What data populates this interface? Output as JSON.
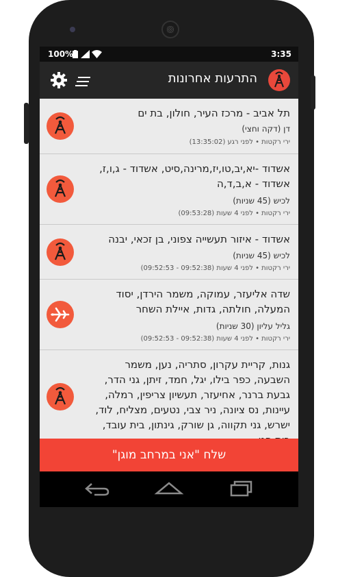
{
  "status_bar": {
    "battery": "100%",
    "time": "3:35"
  },
  "app_bar": {
    "title": "התרעות אחרונות"
  },
  "alerts": [
    {
      "cities": "תל אביב - מרכז העיר, חולון, בת ים",
      "duration": "דן (דקה וחצי)",
      "meta": "ירי רקטות • לפני רגע (13:35:02)",
      "icon": "rocket-tower-icon"
    },
    {
      "cities": "אשדוד -יא,יב,טו,יז,מרינה,סיט, אשדוד - ג,ו,ז, אשדוד - א,ב,ד,ה",
      "duration": "לכיש (45 שניות)",
      "meta": "ירי רקטות • לפני 4 שעות (09:53:28)",
      "icon": "rocket-tower-icon"
    },
    {
      "cities": "אשדוד - איזור תעשייה צפוני, בן זכאי, יבנה",
      "duration": "לכיש (45 שניות)",
      "meta": "ירי רקטות • לפני 4 שעות (09:52:38 - 09:52:53)",
      "icon": "rocket-tower-icon"
    },
    {
      "cities": "שדה אליעזר, עמוקה, משמר הירדן, יסוד המעלה, חולתה, גדות, איילת השחר",
      "duration": "גליל עליון (30 שניות)",
      "meta": "ירי רקטות • לפני 4 שעות (09:52:38 - 09:52:53)",
      "icon": "airplane-icon"
    },
    {
      "cities": "גנות, קריית עקרון, סתריה, נען, משמר השבעה, כפר בילו, יגל, חמד, זיתן, גני הדר, גבעת ברנר, אחיעזר, תעשיון צריפין, רמלה, עיינות, נס ציונה, ניר צבי, נטעים, מצליח, לוד, ישרש, גני תקווה, גן שורק, גינתון, בית עובד, בית חנן,",
      "duration": "",
      "meta": "",
      "icon": "rocket-tower-icon"
    }
  ],
  "cta": {
    "label": "שלח \"אני במרחב מוגן\""
  },
  "colors": {
    "accent": "#f24436",
    "badge": "#f25a3c",
    "appbar": "#262626",
    "background": "#ebebeb"
  }
}
